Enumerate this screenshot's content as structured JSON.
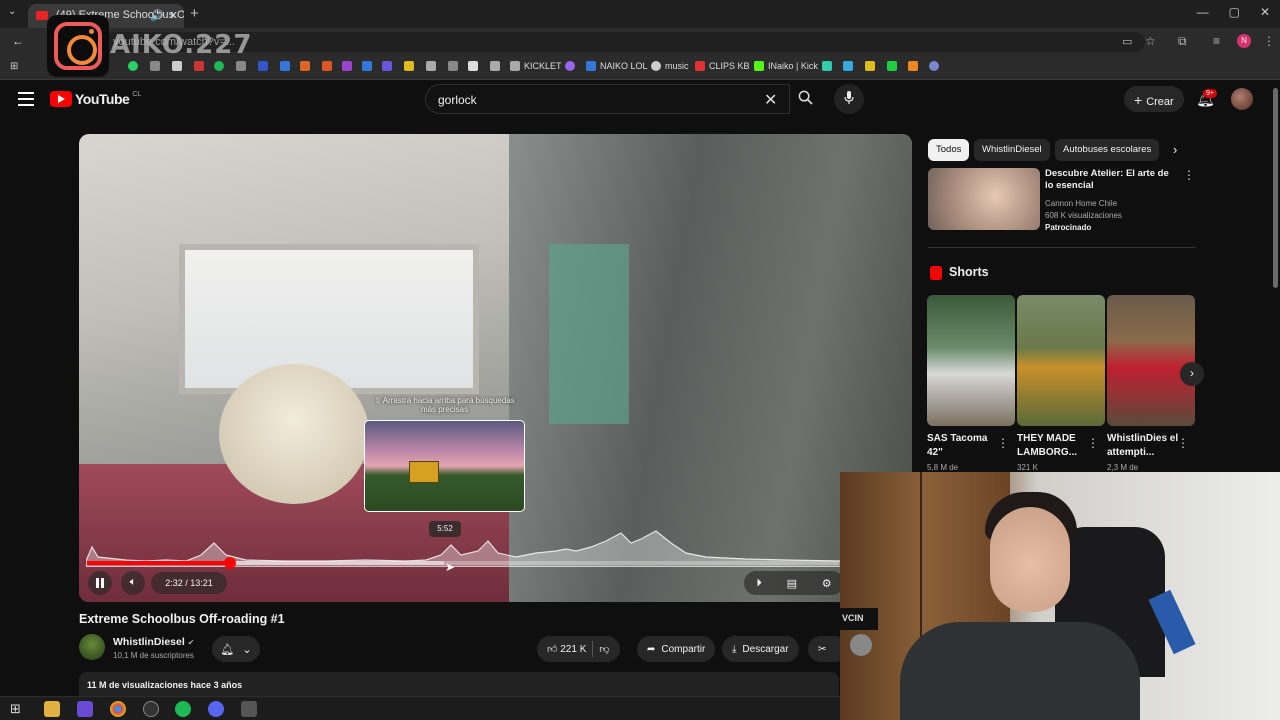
{
  "browser": {
    "tab_title": "(49) Extreme Schoolbus Off...",
    "new_tab": "+",
    "url": "youtube.com/watch?v=...",
    "window_controls": [
      "—",
      "▢",
      "✕"
    ],
    "bookmarks": [
      {
        "label": "",
        "color": "#25d366"
      },
      {
        "label": "",
        "color": "#888888"
      },
      {
        "label": "",
        "color": "#cccccc"
      },
      {
        "label": "",
        "color": "#cc3333"
      },
      {
        "label": "",
        "color": "#1db954"
      },
      {
        "label": "",
        "color": "#888888"
      },
      {
        "label": "",
        "color": "#3355cc"
      },
      {
        "label": "",
        "color": "#3377dd"
      },
      {
        "label": "",
        "color": "#dd6622"
      },
      {
        "label": "",
        "color": "#9944cc"
      },
      {
        "label": "KICKLET",
        "color": "#aaaaaa"
      },
      {
        "label": "NAIKO LOL",
        "color": "#3377dd"
      },
      {
        "label": "music",
        "color": "#cccccc"
      },
      {
        "label": "CLIPS KB",
        "color": "#dd3333"
      },
      {
        "label": "INaiko | Kick",
        "color": "#53fc18"
      }
    ]
  },
  "overlay": {
    "instagram_handle": "AIKO.227"
  },
  "header": {
    "logo_word": "YouTube",
    "logo_country": "CL",
    "search_value": "gorlock",
    "create_label": "Crear",
    "notification_badge": "9+"
  },
  "player": {
    "drag_hint": "⇧ Arrastra hacia arriba para búsquedas más precisas",
    "preview_time": "5:52",
    "time_display": "2:32 / 13:21",
    "progress_fraction": 0.19,
    "hover_fraction": 0.475
  },
  "video": {
    "title": "Extreme Schoolbus Off-roading #1",
    "channel_name": "WhistlinDiesel",
    "subscribers": "10,1 M de suscriptores",
    "likes": "221 K",
    "share_label": "Compartir",
    "download_label": "Descargar",
    "views_date": "11 M de visualizaciones  hace 3 años"
  },
  "sidebar": {
    "chips": [
      "Todos",
      "WhistlinDiesel",
      "Autobuses escolares"
    ],
    "ad": {
      "title": "Descubre Atelier: El arte de lo esencial",
      "brand": "Cannon Home Chile",
      "views": "608 K visualizaciones",
      "sponsored": "Patrocinado"
    },
    "shorts_label": "Shorts",
    "shorts": [
      {
        "title": "SAS Tacoma 42\"",
        "views": "5,8 M de"
      },
      {
        "title": "THEY MADE LAMBORG...",
        "views": "321 K"
      },
      {
        "title": "WhistlinDies el attempti...",
        "views": "2,3 M de"
      }
    ]
  },
  "webcam": {
    "sticker_text": "VCIN"
  }
}
